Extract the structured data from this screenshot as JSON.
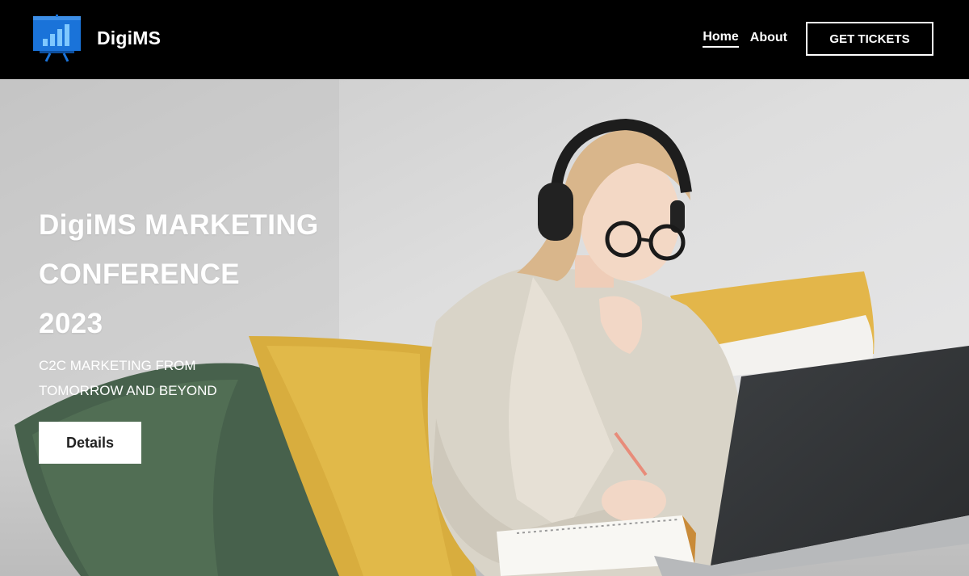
{
  "header": {
    "brand_name": "DigiMS",
    "logo_icon": "presentation-board-chart-icon",
    "nav": {
      "home_label": "Home",
      "about_label": "About",
      "tickets_label": "GET TICKETS"
    }
  },
  "hero": {
    "title_lines": [
      "DigiMS MARKETING",
      "CONFERENCE",
      "2023"
    ],
    "subtitle_lines": [
      "C2C MARKETING FROM",
      "TOMORROW AND BEYOND"
    ],
    "details_label": "Details"
  },
  "colors": {
    "header_bg": "#000000",
    "logo_blue": "#1a73d9",
    "text_white": "#ffffff",
    "button_bg": "#ffffff"
  }
}
